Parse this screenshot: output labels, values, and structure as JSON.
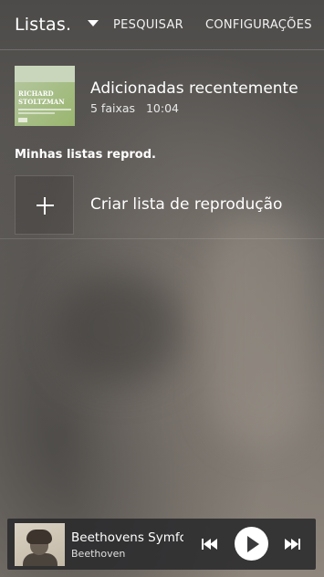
{
  "header": {
    "title": "Listas.",
    "dropdown_icon": "dropdown-arrow-icon",
    "search_label": "PESQUISAR",
    "settings_label": "CONFIGURAÇÕES"
  },
  "recent": {
    "cover_artist_line1": "RICHARD",
    "cover_artist_line2": "STOLTZMAN",
    "name": "Adicionadas recentemente",
    "tracks": "5 faixas",
    "duration": "10:04"
  },
  "playlists": {
    "section_title": "Minhas listas reprod.",
    "create_label": "Criar lista de reprodução",
    "create_icon": "plus-icon"
  },
  "player": {
    "track_title": "Beethovens Symfo",
    "artist": "Beethoven",
    "prev_icon": "skip-previous-icon",
    "play_icon": "play-icon",
    "next_icon": "skip-next-icon"
  },
  "colors": {
    "text": "#ffffff",
    "player_bg": "#2a2a2c",
    "play_button": "#ffffff"
  }
}
